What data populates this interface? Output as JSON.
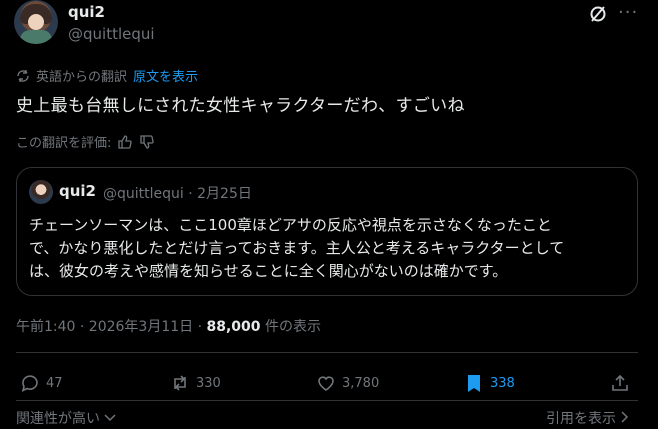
{
  "author": {
    "name": "qui2",
    "handle": "@quittlequi"
  },
  "translation": {
    "label": "英語からの翻訳",
    "show_original": "原文を表示",
    "rate_label": "この翻訳を評価:"
  },
  "tweet": {
    "text": "史上最も台無しにされた女性キャラクターだわ、すごいね"
  },
  "quote": {
    "name": "qui2",
    "handle_date": "@quittlequi · 2月25日",
    "lines": [
      "チェーンソーマンは、ここ100章ほどアサの反応や視点を示さなくなったこと",
      "で、かなり悪化したとだけ言っておきます。主人公と考えるキャラクターとして",
      "は、彼女の考えや感情を知らせることに全く関心がないのは確かです。"
    ]
  },
  "meta": {
    "time": "午前1:40 · 2026年3月11日 · ",
    "views": "88,000",
    "views_suffix": " 件の表示"
  },
  "actions": {
    "replies": "47",
    "reposts": "330",
    "likes": "3,780",
    "bookmarks": "338"
  },
  "footer": {
    "sort": "関連性が高い",
    "quotes": "引用を表示"
  },
  "colors": {
    "accent": "#1d9bf0",
    "muted": "#71767b",
    "text": "#e7e9ea",
    "border": "#2f3336"
  }
}
